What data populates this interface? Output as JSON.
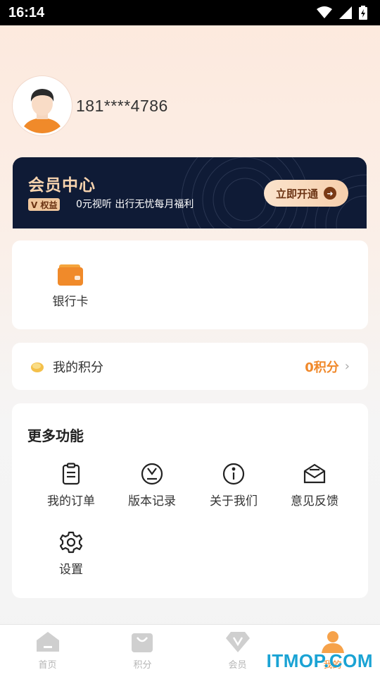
{
  "status_bar": {
    "time": "16:14"
  },
  "profile": {
    "phone": "181****4786"
  },
  "vip_banner": {
    "title": "会员中心",
    "badge": "V 权益",
    "description": "0元视听 出行无忧每月福利",
    "button_label": "立即开通"
  },
  "bank": {
    "label": "银行卡"
  },
  "points": {
    "label": "我的积分",
    "value": "0积分"
  },
  "more": {
    "title": "更多功能",
    "items": [
      {
        "label": "我的订单",
        "icon": "clipboard-icon"
      },
      {
        "label": "版本记录",
        "icon": "version-icon"
      },
      {
        "label": "关于我们",
        "icon": "info-icon"
      },
      {
        "label": "意见反馈",
        "icon": "mail-icon"
      },
      {
        "label": "设置",
        "icon": "gear-icon"
      }
    ]
  },
  "tabbar": {
    "tabs": [
      {
        "label": "首页",
        "icon": "home-icon"
      },
      {
        "label": "积分",
        "icon": "bag-icon"
      },
      {
        "label": "会员",
        "icon": "diamond-icon"
      },
      {
        "label": "我的",
        "icon": "person-icon",
        "active": true
      }
    ]
  },
  "watermark": "ITMOP.COM",
  "colors": {
    "accent": "#f0892b",
    "vip_bg": "#0f1b36",
    "vip_gold": "#f7d3ae"
  }
}
